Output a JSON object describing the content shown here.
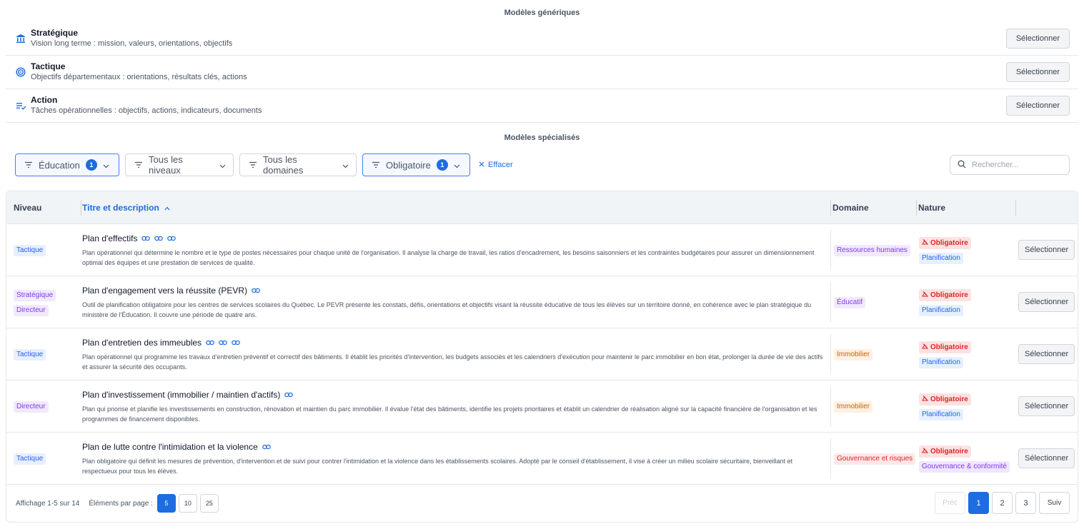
{
  "generic": {
    "title": "Modèles génériques",
    "select_label": "Sélectionner",
    "items": [
      {
        "icon": "bank-icon",
        "title": "Stratégique",
        "desc": "Vision long terme : mission, valeurs, orientations, objectifs"
      },
      {
        "icon": "target-icon",
        "title": "Tactique",
        "desc": "Objectifs départementaux : orientations, résultats clés, actions"
      },
      {
        "icon": "checklist-icon",
        "title": "Action",
        "desc": "Tâches opérationnelles : objectifs, actions, indicateurs, documents"
      }
    ]
  },
  "specialized": {
    "title": "Modèles spécialisés",
    "filters": [
      {
        "label": "Éducation",
        "count": "1",
        "active": true
      },
      {
        "label": "Tous les niveaux",
        "count": null,
        "active": false
      },
      {
        "label": "Tous les domaines",
        "count": null,
        "active": false
      },
      {
        "label": "Obligatoire",
        "count": "1",
        "active": true
      }
    ],
    "clear_label": "Effacer",
    "search_placeholder": "Rechercher..."
  },
  "table": {
    "headers": {
      "niveau": "Niveau",
      "titre": "Titre et description",
      "domaine": "Domaine",
      "nature": "Nature"
    },
    "select_label": "Sélectionner",
    "rows": [
      {
        "niveaux": [
          {
            "label": "Tactique",
            "color": "blue"
          }
        ],
        "title": "Plan d'effectifs",
        "links": 3,
        "desc": "Plan opérationnel qui détermine le nombre et le type de postes nécessaires pour chaque unité de l'organisation. Il analyse la charge de travail, les ratios d'encadrement, les besoins saisonniers et les contraintes budgétaires pour assurer un dimensionnement optimal des équipes et une prestation de services de qualité.",
        "domain": {
          "label": "Ressources humaines",
          "color": "purple"
        },
        "nature": [
          {
            "label": "Obligatoire",
            "color": "red-strong"
          },
          {
            "label": "Planification",
            "color": "lblue"
          }
        ]
      },
      {
        "niveaux": [
          {
            "label": "Stratégique",
            "color": "purple"
          },
          {
            "label": "Directeur",
            "color": "purple"
          }
        ],
        "title": "Plan d'engagement vers la réussite (PEVR)",
        "links": 1,
        "desc": "Outil de planification obligatoire pour les centres de services scolaires du Québec. Le PEVR présente les constats, défis, orientations et objectifs visant la réussite éducative de tous les élèves sur un territoire donné, en cohérence avec le plan stratégique du ministère de l'Éducation. Il couvre une période de quatre ans.",
        "domain": {
          "label": "Éducatif",
          "color": "purple"
        },
        "nature": [
          {
            "label": "Obligatoire",
            "color": "red-strong"
          },
          {
            "label": "Planification",
            "color": "lblue"
          }
        ]
      },
      {
        "niveaux": [
          {
            "label": "Tactique",
            "color": "blue"
          }
        ],
        "title": "Plan d'entretien des immeubles",
        "links": 3,
        "desc": "Plan opérationnel qui programme les travaux d'entretien préventif et correctif des bâtiments. Il établit les priorités d'intervention, les budgets associés et les calendriers d'exécution pour maintenir le parc immobilier en bon état, prolonger la durée de vie des actifs et assurer la sécurité des occupants.",
        "domain": {
          "label": "Immobilier",
          "color": "orange"
        },
        "nature": [
          {
            "label": "Obligatoire",
            "color": "red-strong"
          },
          {
            "label": "Planification",
            "color": "lblue"
          }
        ]
      },
      {
        "niveaux": [
          {
            "label": "Directeur",
            "color": "purple"
          }
        ],
        "title": "Plan d'investissement (immobilier / maintien d'actifs)",
        "links": 1,
        "desc": "Plan qui priorise et planifie les investissements en construction, rénovation et maintien du parc immobilier. Il évalue l'état des bâtiments, identifie les projets prioritaires et établit un calendrier de réalisation aligné sur la capacité financière de l'organisation et les programmes de financement disponibles.",
        "domain": {
          "label": "Immobilier",
          "color": "orange"
        },
        "nature": [
          {
            "label": "Obligatoire",
            "color": "red-strong"
          },
          {
            "label": "Planification",
            "color": "lblue"
          }
        ]
      },
      {
        "niveaux": [
          {
            "label": "Tactique",
            "color": "blue"
          }
        ],
        "title": "Plan de lutte contre l'intimidation et la violence",
        "links": 1,
        "desc": "Plan obligatoire qui définit les mesures de prévention, d'intervention et de suivi pour contrer l'intimidation et la violence dans les établissements scolaires. Adopté par le conseil d'établissement, il vise à créer un milieu scolaire sécuritaire, bienveillant et respectueux pour tous les élèves.",
        "domain": {
          "label": "Gouvernance et risques",
          "color": "red"
        },
        "nature": [
          {
            "label": "Obligatoire",
            "color": "red-strong"
          },
          {
            "label": "Gouvernance & conformité",
            "color": "violet"
          }
        ]
      }
    ]
  },
  "footer": {
    "showing": "Affichage 1-5 sur 14",
    "per_page_label": "Éléments par page :",
    "per_page_options": [
      "5",
      "10",
      "25"
    ],
    "per_page_selected": "5",
    "prev_label": "Préc",
    "next_label": "Suiv",
    "pages": [
      "1",
      "2",
      "3"
    ],
    "current_page": "1"
  }
}
